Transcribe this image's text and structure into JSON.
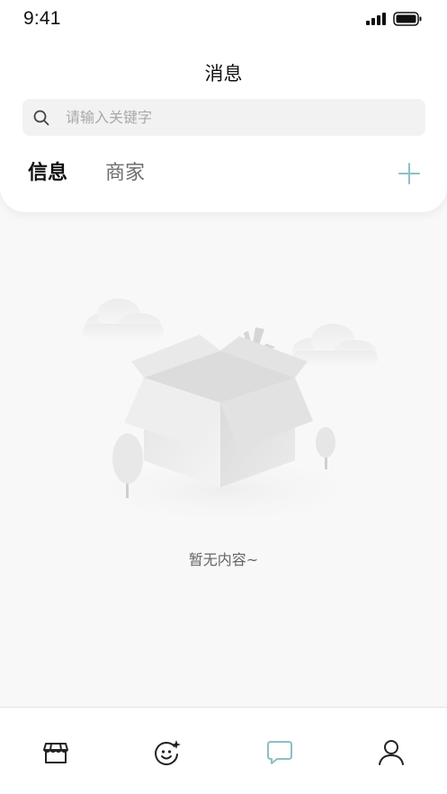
{
  "status_bar": {
    "time": "9:41"
  },
  "header": {
    "title": "消息"
  },
  "search": {
    "placeholder": "请输入关键字"
  },
  "tabs": [
    {
      "label": "信息",
      "active": true
    },
    {
      "label": "商家",
      "active": false
    }
  ],
  "empty_state": {
    "text": "暂无内容~"
  },
  "tabbar": {
    "items": [
      {
        "icon": "store-icon",
        "active": false
      },
      {
        "icon": "smiley-sparkle-icon",
        "active": false
      },
      {
        "icon": "chat-bubble-icon",
        "active": true
      },
      {
        "icon": "user-icon",
        "active": false
      }
    ]
  },
  "colors": {
    "accent": "#8dbfc4",
    "icon_default": "#222222",
    "background": "#f8f8f8"
  }
}
